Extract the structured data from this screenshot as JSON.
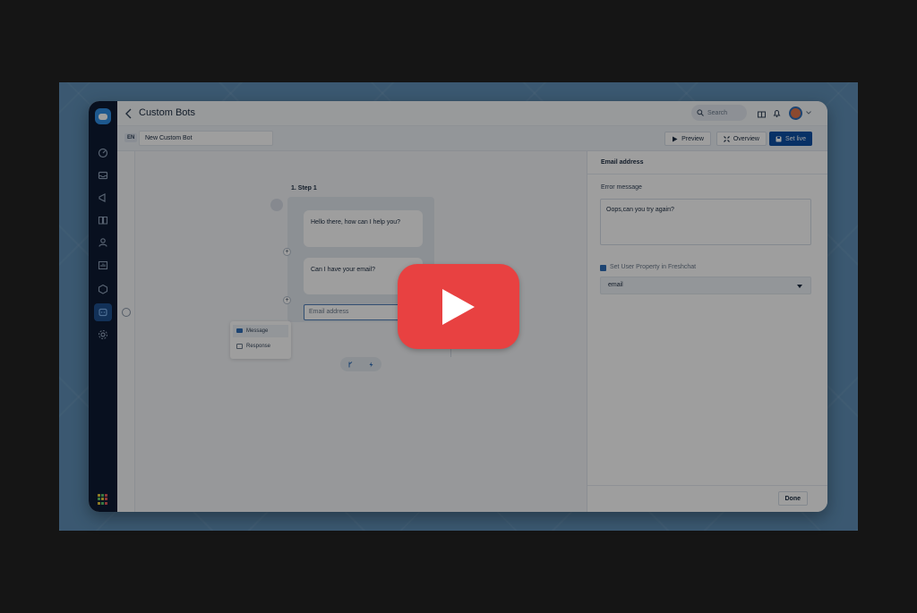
{
  "header": {
    "title": "Custom Bots",
    "search_placeholder": "Search"
  },
  "subbar": {
    "language": "EN",
    "bot_name": "New Custom Bot",
    "preview_label": "Preview",
    "overview_label": "Overview",
    "set_live_label": "Set live"
  },
  "canvas": {
    "step_label": "1. Step 1",
    "message_1": "Hello there, how can I help you?",
    "message_2": "Can I have your email?",
    "input_placeholder": "Email address",
    "menu": {
      "item_1": "Message",
      "item_2": "Response"
    }
  },
  "panel": {
    "title": "Email address",
    "error_label": "Error message",
    "error_value": "Oops,can you try again?",
    "property_label": "Set User Property in Freshchat",
    "property_checked": true,
    "property_value": "email",
    "done_label": "Done"
  },
  "sidebar": {
    "items": [
      "dashboard-icon",
      "inbox-icon",
      "campaigns-icon",
      "knowledge-base-icon",
      "contacts-icon",
      "reports-icon",
      "apps-box-icon",
      "bots-icon",
      "settings-icon"
    ],
    "active_index": 7
  },
  "colors": {
    "accent": "#0d4fa5",
    "rail": "#0d1b33",
    "play": "#e84141",
    "backdrop": "#5f8fb6"
  }
}
